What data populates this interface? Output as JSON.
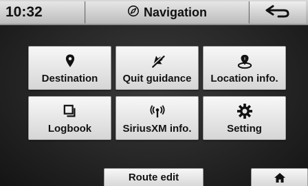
{
  "status_bar": {
    "time": "10:32",
    "title": "Navigation",
    "title_icon": "compass-icon",
    "back_icon": "back-arrow-icon"
  },
  "menu": {
    "items": [
      {
        "label": "Destination",
        "icon": "map-pin-icon"
      },
      {
        "label": "Quit guidance",
        "icon": "quit-guidance-icon"
      },
      {
        "label": "Location info.",
        "icon": "location-info-icon"
      },
      {
        "label": "Logbook",
        "icon": "logbook-icon"
      },
      {
        "label": "SiriusXM info.",
        "icon": "signal-icon"
      },
      {
        "label": "Setting",
        "icon": "gear-icon"
      }
    ]
  },
  "bottom_bar": {
    "route_edit_label": "Route edit",
    "home_icon": "home-icon"
  }
}
